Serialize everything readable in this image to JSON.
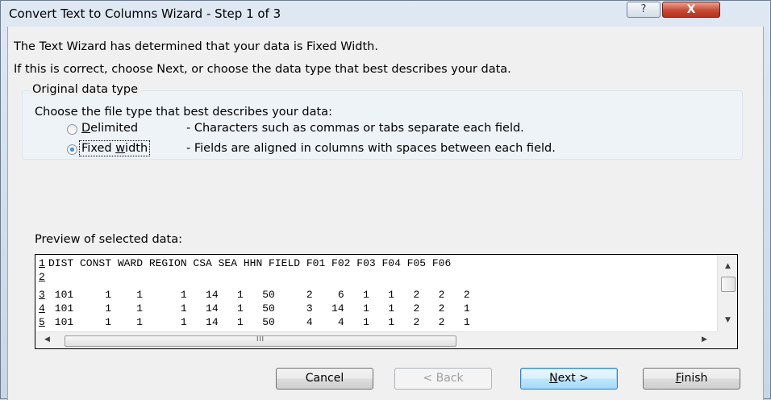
{
  "window": {
    "title": "Convert Text to Columns Wizard - Step 1 of 3",
    "help_label": "?",
    "close_label": "X"
  },
  "intro": {
    "line1": "The Text Wizard has determined that your data is Fixed Width.",
    "line2": "If this is correct, choose Next, or choose the data type that best describes your data."
  },
  "original_data_type": {
    "legend": "Original data type",
    "prompt": "Choose the file type that best describes your data:",
    "options": [
      {
        "label_mnemonic": "D",
        "label_rest": "elimited",
        "description": "- Characters such as commas or tabs separate each field.",
        "selected": false
      },
      {
        "label_pre": "Fixed ",
        "label_mnemonic": "w",
        "label_rest": "idth",
        "description": "- Fields are aligned in columns with spaces between each field.",
        "selected": true
      }
    ]
  },
  "preview": {
    "label": "Preview of selected data:",
    "rows": [
      {
        "num": "1",
        "text": "DIST CONST WARD REGION CSA SEA HHN FIELD F01 F02 F03 F04 F05 F06"
      },
      {
        "num": "2",
        "text": ""
      },
      {
        "num": "3",
        "text": " 101     1    1      1   14   1   50     2    6   1   1   2   2   2"
      },
      {
        "num": "4",
        "text": " 101     1    1      1   14   1   50     3   14   1   1   2   2   1"
      },
      {
        "num": "5",
        "text": " 101     1    1      1   14   1   50     4    4   1   1   2   2   1"
      }
    ],
    "vscroll_up": "▲",
    "vscroll_down": "▼",
    "hscroll_left": "◀",
    "hscroll_grip": "III",
    "hscroll_right": "▶"
  },
  "buttons": {
    "cancel": "Cancel",
    "back": "< Back",
    "next_mnemonic": "N",
    "next_rest": "ext >",
    "finish_mnemonic": "F",
    "finish_rest": "inish"
  }
}
